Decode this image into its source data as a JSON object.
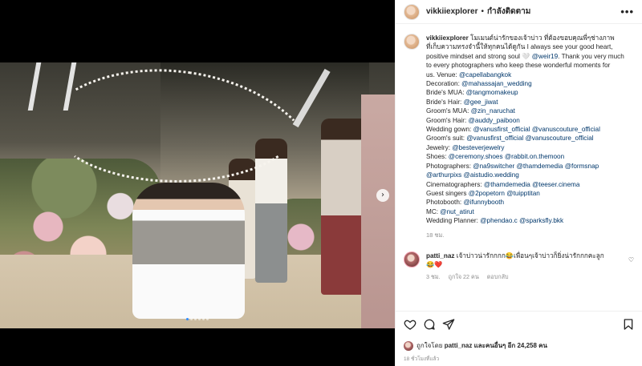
{
  "post": {
    "username": "vikkiiexplorer",
    "separator": "•",
    "follow_label": "กำลังติดตาม",
    "more_label": "•••"
  },
  "caption": {
    "username": "vikkiiexplorer",
    "lines": [
      "โมเมนต์น่ารักของเจ้าบ่าว ที่ต้องขอบคุณพี่ๆช่างภาพ",
      "ที่เก็บความทรงจำนี้ให้ทุกคนได้ดูกัน I always see your good heart,",
      "positive mindset and strong soul 🤍 @weir19. Thank you very much",
      "to every photographers who keep these wonderful moments for",
      "us. Venue: @capellabangkok",
      "Decoration: @mahassajan_wedding",
      "Bride's MUA: @tangmomakeup",
      "Bride's Hair: @gee_jiwat",
      "Groom's MUA: @zin_naruchat",
      "Groom's Hair: @auddy_paiboon",
      "Wedding gown: @vanusfirst_official @vanuscouture_official",
      "Groom's suit: @vanusfirst_official @vanuscouture_official",
      "Jewelry: @besteverjewelry",
      "Shoes: @ceremony.shoes @rabbit.on.themoon",
      "Photographers: @na9switcher @thamdemedia @formsnap",
      "@arthurpixs @aistudio.wedding",
      "Cinematographers: @thamdemedia @teeser.cinema",
      "Guest singers @2popetorn @tuipptitan",
      "Photobooth: @ifunnybooth",
      "MC: @nut_atirut",
      "Wedding Planner: @phendao.c @sparksfly.bkk"
    ],
    "time": "18 ชม."
  },
  "comment": {
    "username": "patti_naz",
    "text_line1": "เจ้าบ่าวน่ารักกกก😂เพื่อนๆเจ้าบ่าวก็ยิ่งน่ารักกกคะลูก",
    "text_line2": "😂❤️",
    "time": "3 ชม.",
    "likes": "ถูกใจ 22 คน",
    "reply": "ตอบกลับ"
  },
  "likes": {
    "prefix": "ถูกใจโดย",
    "liked_by": "patti_naz",
    "middle": "และคนอื่นๆ อีก",
    "count": "24,258",
    "suffix": "คน"
  },
  "posted": "18 ชั่วโมงที่แล้ว",
  "carousel": {
    "next_label": "›",
    "slides": 6,
    "active_index": 0
  },
  "colors": {
    "mention": "#00376b",
    "muted": "#8e8e8e",
    "active_dot": "#2f8cff"
  },
  "icons": [
    "heart-icon",
    "comment-icon",
    "share-icon",
    "bookmark-icon",
    "chevron-right-icon",
    "more-icon"
  ]
}
